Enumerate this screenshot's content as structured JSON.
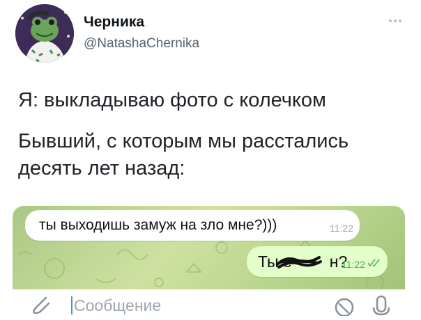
{
  "author": {
    "display_name": "Черника",
    "handle": "@NatashaChernika"
  },
  "tweet": {
    "lines": [
      "Я: выкладываю фото с колечком",
      "Бывший, с которым мы расстались",
      "десять лет назад:"
    ]
  },
  "chat": {
    "incoming": {
      "text": "ты выходишь замуж на зло мне?)))",
      "time": "11:22"
    },
    "outgoing": {
      "text_before": "Ты е",
      "text_after": "н?",
      "time": "11:22",
      "status": "read-double-check-icon"
    },
    "input": {
      "placeholder": "Сообщение"
    }
  },
  "icons": {
    "more": "more-dots-icon",
    "attach": "paperclip-icon",
    "sticker": "sticker-icon",
    "voice": "microphone-icon"
  },
  "colors": {
    "chat_bg": "#b6d38b",
    "bubble_out": "#e2fec9",
    "time_out": "#4fae4e",
    "handle": "#536471"
  }
}
